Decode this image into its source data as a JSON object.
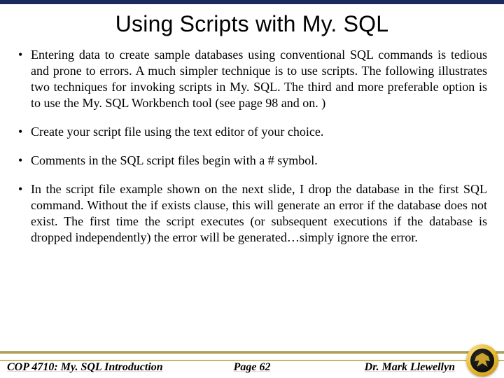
{
  "title": "Using Scripts with My. SQL",
  "bullets": [
    "Entering data to create sample databases using conventional SQL commands is tedious and prone to errors.  A much simpler technique is to use scripts.  The following illustrates two techniques for invoking scripts in My. SQL.  The third and more preferable option is to use the My. SQL Workbench tool (see page 98 and on. )",
    "Create your script file using the text editor of your choice.",
    "Comments in the SQL script files begin with a  # symbol.",
    "In the script file example shown on the next slide, I drop the database in the first SQL command.  Without the if exists clause, this will generate an error if the database does not exist.  The first time the script executes (or subsequent executions if the database is dropped independently) the error will be generated…simply ignore the error."
  ],
  "footer": {
    "left": "COP 4710: My. SQL Introduction",
    "center": "Page 62",
    "right": "Dr. Mark Llewellyn"
  }
}
